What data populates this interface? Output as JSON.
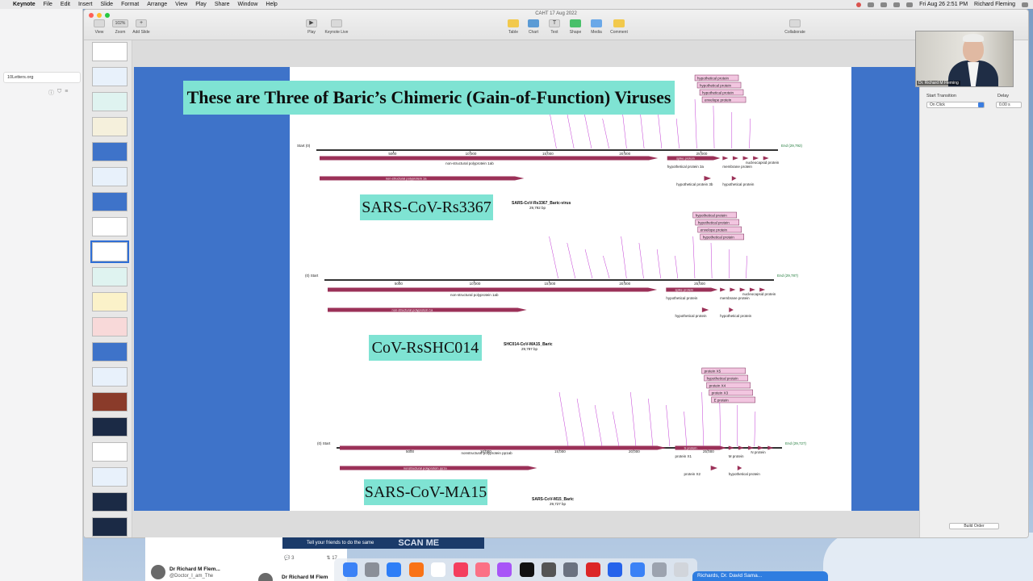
{
  "menubar": {
    "app_name": "Keynote",
    "menus": [
      "File",
      "Edit",
      "Insert",
      "Slide",
      "Format",
      "Arrange",
      "View",
      "Play",
      "Share",
      "Window",
      "Help"
    ],
    "datetime": "Fri Aug 26  2:51 PM",
    "user": "Richard Fleming"
  },
  "browser": {
    "tab_title": "10Letters.org"
  },
  "window": {
    "doc_title": "CAHT 17 Aug 2022",
    "toolbar_left": [
      {
        "label": "View",
        "icon": "sidebar-icon"
      },
      {
        "label": "Zoom",
        "value": "102%"
      },
      {
        "label": "Add Slide",
        "icon": "plus-icon"
      }
    ],
    "toolbar_center": [
      {
        "label": "Play",
        "icon": "play-icon"
      },
      {
        "label": "Keynote Live",
        "icon": "keynote-live-icon"
      }
    ],
    "toolbar_insert": [
      {
        "label": "Table",
        "icon": "table-icon",
        "color": "#f2c94c"
      },
      {
        "label": "Chart",
        "icon": "chart-icon",
        "color": "#5b9bd5"
      },
      {
        "label": "Text",
        "icon": "text-icon",
        "color": "#cfcfcf"
      },
      {
        "label": "Shape",
        "icon": "shape-icon",
        "color": "#49c06a"
      },
      {
        "label": "Media",
        "icon": "media-icon",
        "color": "#6aa8e8"
      },
      {
        "label": "Comment",
        "icon": "comment-icon",
        "color": "#f2c94c"
      }
    ],
    "toolbar_right": [
      {
        "label": "Collaborate",
        "icon": "collaborate-icon"
      }
    ]
  },
  "slide": {
    "title": "These are Three of Baric’s Chimeric (Gain-of-Function) Viruses",
    "virus_labels": [
      "SARS-CoV-Rs3367",
      "CoV-RsSHC014",
      "SARS-CoV-MA15"
    ],
    "maps": [
      {
        "name": "SARS-CoV-Rs3367_Baric-virus",
        "size": "29,792 bp",
        "ticks": [
          "5000",
          "10,000",
          "15,000",
          "20,000",
          "25,000"
        ],
        "start": "Start (0)",
        "end": "End (29,792)",
        "label_pp1ab": "non-structural polyprotein 1ab",
        "label_pp1a": "non-structural polyprotein 1a",
        "label_spike": "spike protein",
        "label_n": "nucleocapsid protein",
        "label_m": "membrane protein",
        "label_hyp": "hypothetical protein 3a",
        "label_hyp2": "hypothetical protein 3b",
        "label_hyp3": "hypothetical protein",
        "boxes": [
          "hypothetical protein",
          "hypothetical protein",
          "hypothetical protein",
          "envelope protein"
        ]
      },
      {
        "name": "SHC014-CoV-MA15_Baric",
        "size": "29,787 bp",
        "ticks": [
          "5000",
          "10,000",
          "15,000",
          "20,000",
          "25,000"
        ],
        "start": "(0) Start",
        "end": "End (29,787)",
        "label_pp1ab": "non-structural polyprotein 1ab",
        "label_pp1a": "non-structural polyprotein 1a",
        "label_spike": "spike protein",
        "label_n": "nucleocapsid protein",
        "label_m": "membrane protein",
        "label_hyp": "hypothetical protein",
        "label_hyp2": "hypothetical protein",
        "label_hyp3": "hypothetical protein",
        "boxes": [
          "hypothetical protein",
          "hypothetical protein",
          "envelope protein",
          "hypothetical protein"
        ]
      },
      {
        "name": "SARS-CoV-M15_Baric",
        "size": "29,727 bp",
        "ticks": [
          "5000",
          "10,000",
          "15,000",
          "20,000",
          "25,000"
        ],
        "start": "(0) Start",
        "end": "End (29,727)",
        "label_pp1ab": "nonstructural polyprotein pp1ab",
        "label_pp1a": "nonstructural polyprotein pp1a",
        "label_spike": "S protein",
        "label_n": "N protein",
        "label_m": "M protein",
        "label_hyp": "protein X1",
        "label_hyp2": "protein X2",
        "label_hyp3": "hypothetical protein",
        "boxes": [
          "protein X5",
          "hypothetical protein",
          "protein X4",
          "protein X3",
          "E protein"
        ]
      }
    ]
  },
  "inspector": {
    "start_transition": "Start Transition",
    "delay": "Delay",
    "select_value": "On Click",
    "delay_value": "0.00 s",
    "build_order": "Build Order"
  },
  "webcam": {
    "name": "Dr. Richard M Fleming"
  },
  "twitter": {
    "banner_text": "Tell your friends to do the same",
    "banner_big": "SCAN ME",
    "name": "Dr Richard M Flem...",
    "handle": "@Doctor_I_am_The",
    "name2": "Dr Richard M Flem",
    "replies": "3",
    "retweets": "17",
    "bottom_pill": "Richards, Dr. David Sama..."
  }
}
